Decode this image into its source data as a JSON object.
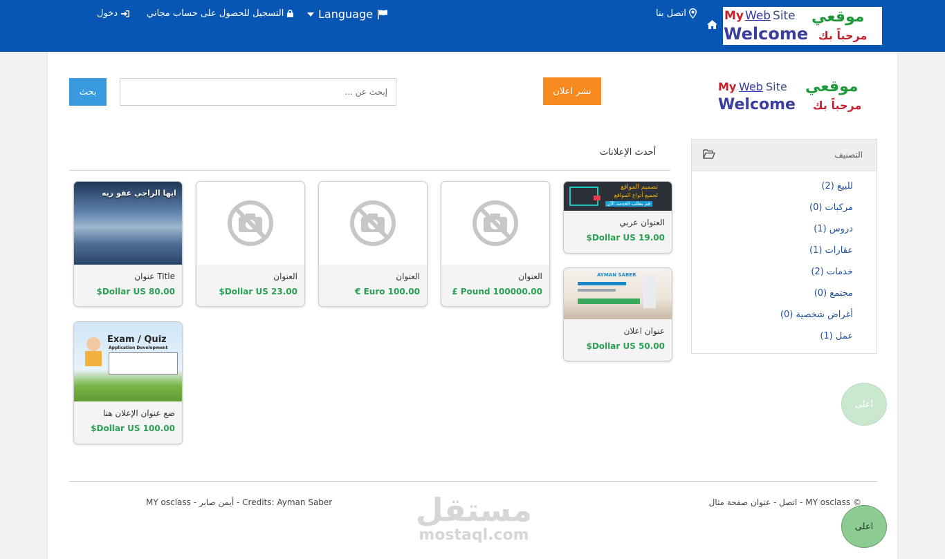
{
  "topbar": {
    "login": "دخول",
    "register": "التسجيل للحصول على حساب مجاني",
    "language": "Language",
    "contact": "اتصل بنا"
  },
  "logo": {
    "my": "My",
    "web": "Web",
    "site": "Site",
    "welcome": "Welcome",
    "arabic_top": "موقعي",
    "arabic_bottom": "مرحباً بك"
  },
  "search": {
    "button": "بحث",
    "placeholder": "إبحث عن ..."
  },
  "post_ad": "نشر اعلان",
  "latest": {
    "title": "أحدث الإعلانات",
    "cards": [
      {
        "title": "العنوان عربي",
        "price": "$Dollar US 19.00"
      },
      {
        "title": "العنوان",
        "price": "£ Pound 100000.00"
      },
      {
        "title": "العنوان",
        "price": "€ Euro 100.00"
      },
      {
        "title": "العنوان",
        "price": "$Dollar US 23.00"
      },
      {
        "title": "Title عنوان",
        "price": "$Dollar US 80.00"
      },
      {
        "title": "عنوان اعلان",
        "price": "$Dollar US 50.00"
      },
      {
        "title": "ضع عنوان الإعلان هنا",
        "price": "$Dollar US 100.00"
      }
    ],
    "image_texts": {
      "card1_line1": "تصميم المواقع",
      "card1_line2": "لجميع أنواع المواقع",
      "card1_line3": "قم بطلب الخدمة الآن",
      "card5_text": "ايها الراجي عفو ربه",
      "card6_brand": "AYMAN SABER",
      "card7_title": "Exam / Quiz",
      "card7_subtitle": "Application Development"
    }
  },
  "categories": {
    "title": "التصنيف",
    "items": [
      "للبيع (2)",
      "مركبات (0)",
      "دروس (1)",
      "عقارات (1)",
      "خدمات (2)",
      "مجتمع (0)",
      "أغراض شخصية (0)",
      "عمل (1)"
    ]
  },
  "footer": {
    "left": "MY osclass - أيمن صابر - Credits: Ayman Saber",
    "right": "© MY osclass - اتصل - عنوان صفحة مثال"
  },
  "watermark": {
    "arabic": "مستقل",
    "english": "mostaql.com"
  },
  "to_top": "اعلى",
  "colors": {
    "topbar": "#0756b3",
    "search_button": "#3a9ae0",
    "post_button": "#f7891f",
    "price": "#2aa152",
    "category_link": "#1f4f9c"
  }
}
